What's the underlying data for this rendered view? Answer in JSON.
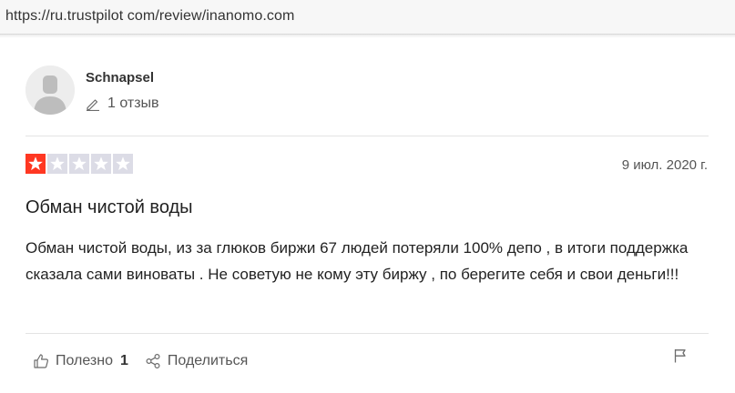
{
  "browser": {
    "url": "https://ru.trustpilot com/review/inanomo.com"
  },
  "reviewer": {
    "name": "Schnapsel",
    "review_count": "1 отзыв",
    "avatar_icon": "user-silhouette-icon"
  },
  "review": {
    "rating": 1,
    "rating_max": 5,
    "star_filled_color": "#ff3722",
    "star_empty_color": "#dcdce6",
    "date": "9 июл. 2020 г.",
    "title": "Обман чистой воды",
    "body": "Обман чистой воды, из за глюков биржи 67 людей потеряли 100% депо , в итоги поддержка сказала сами виноваты . Не советую не кому эту биржу , по берегите себя и свои деньги!!!"
  },
  "actions": {
    "useful_label": "Полезно",
    "useful_count": "1",
    "share_label": "Поделиться",
    "useful_icon": "thumbs-up-icon",
    "share_icon": "share-icon",
    "report_icon": "flag-icon"
  }
}
